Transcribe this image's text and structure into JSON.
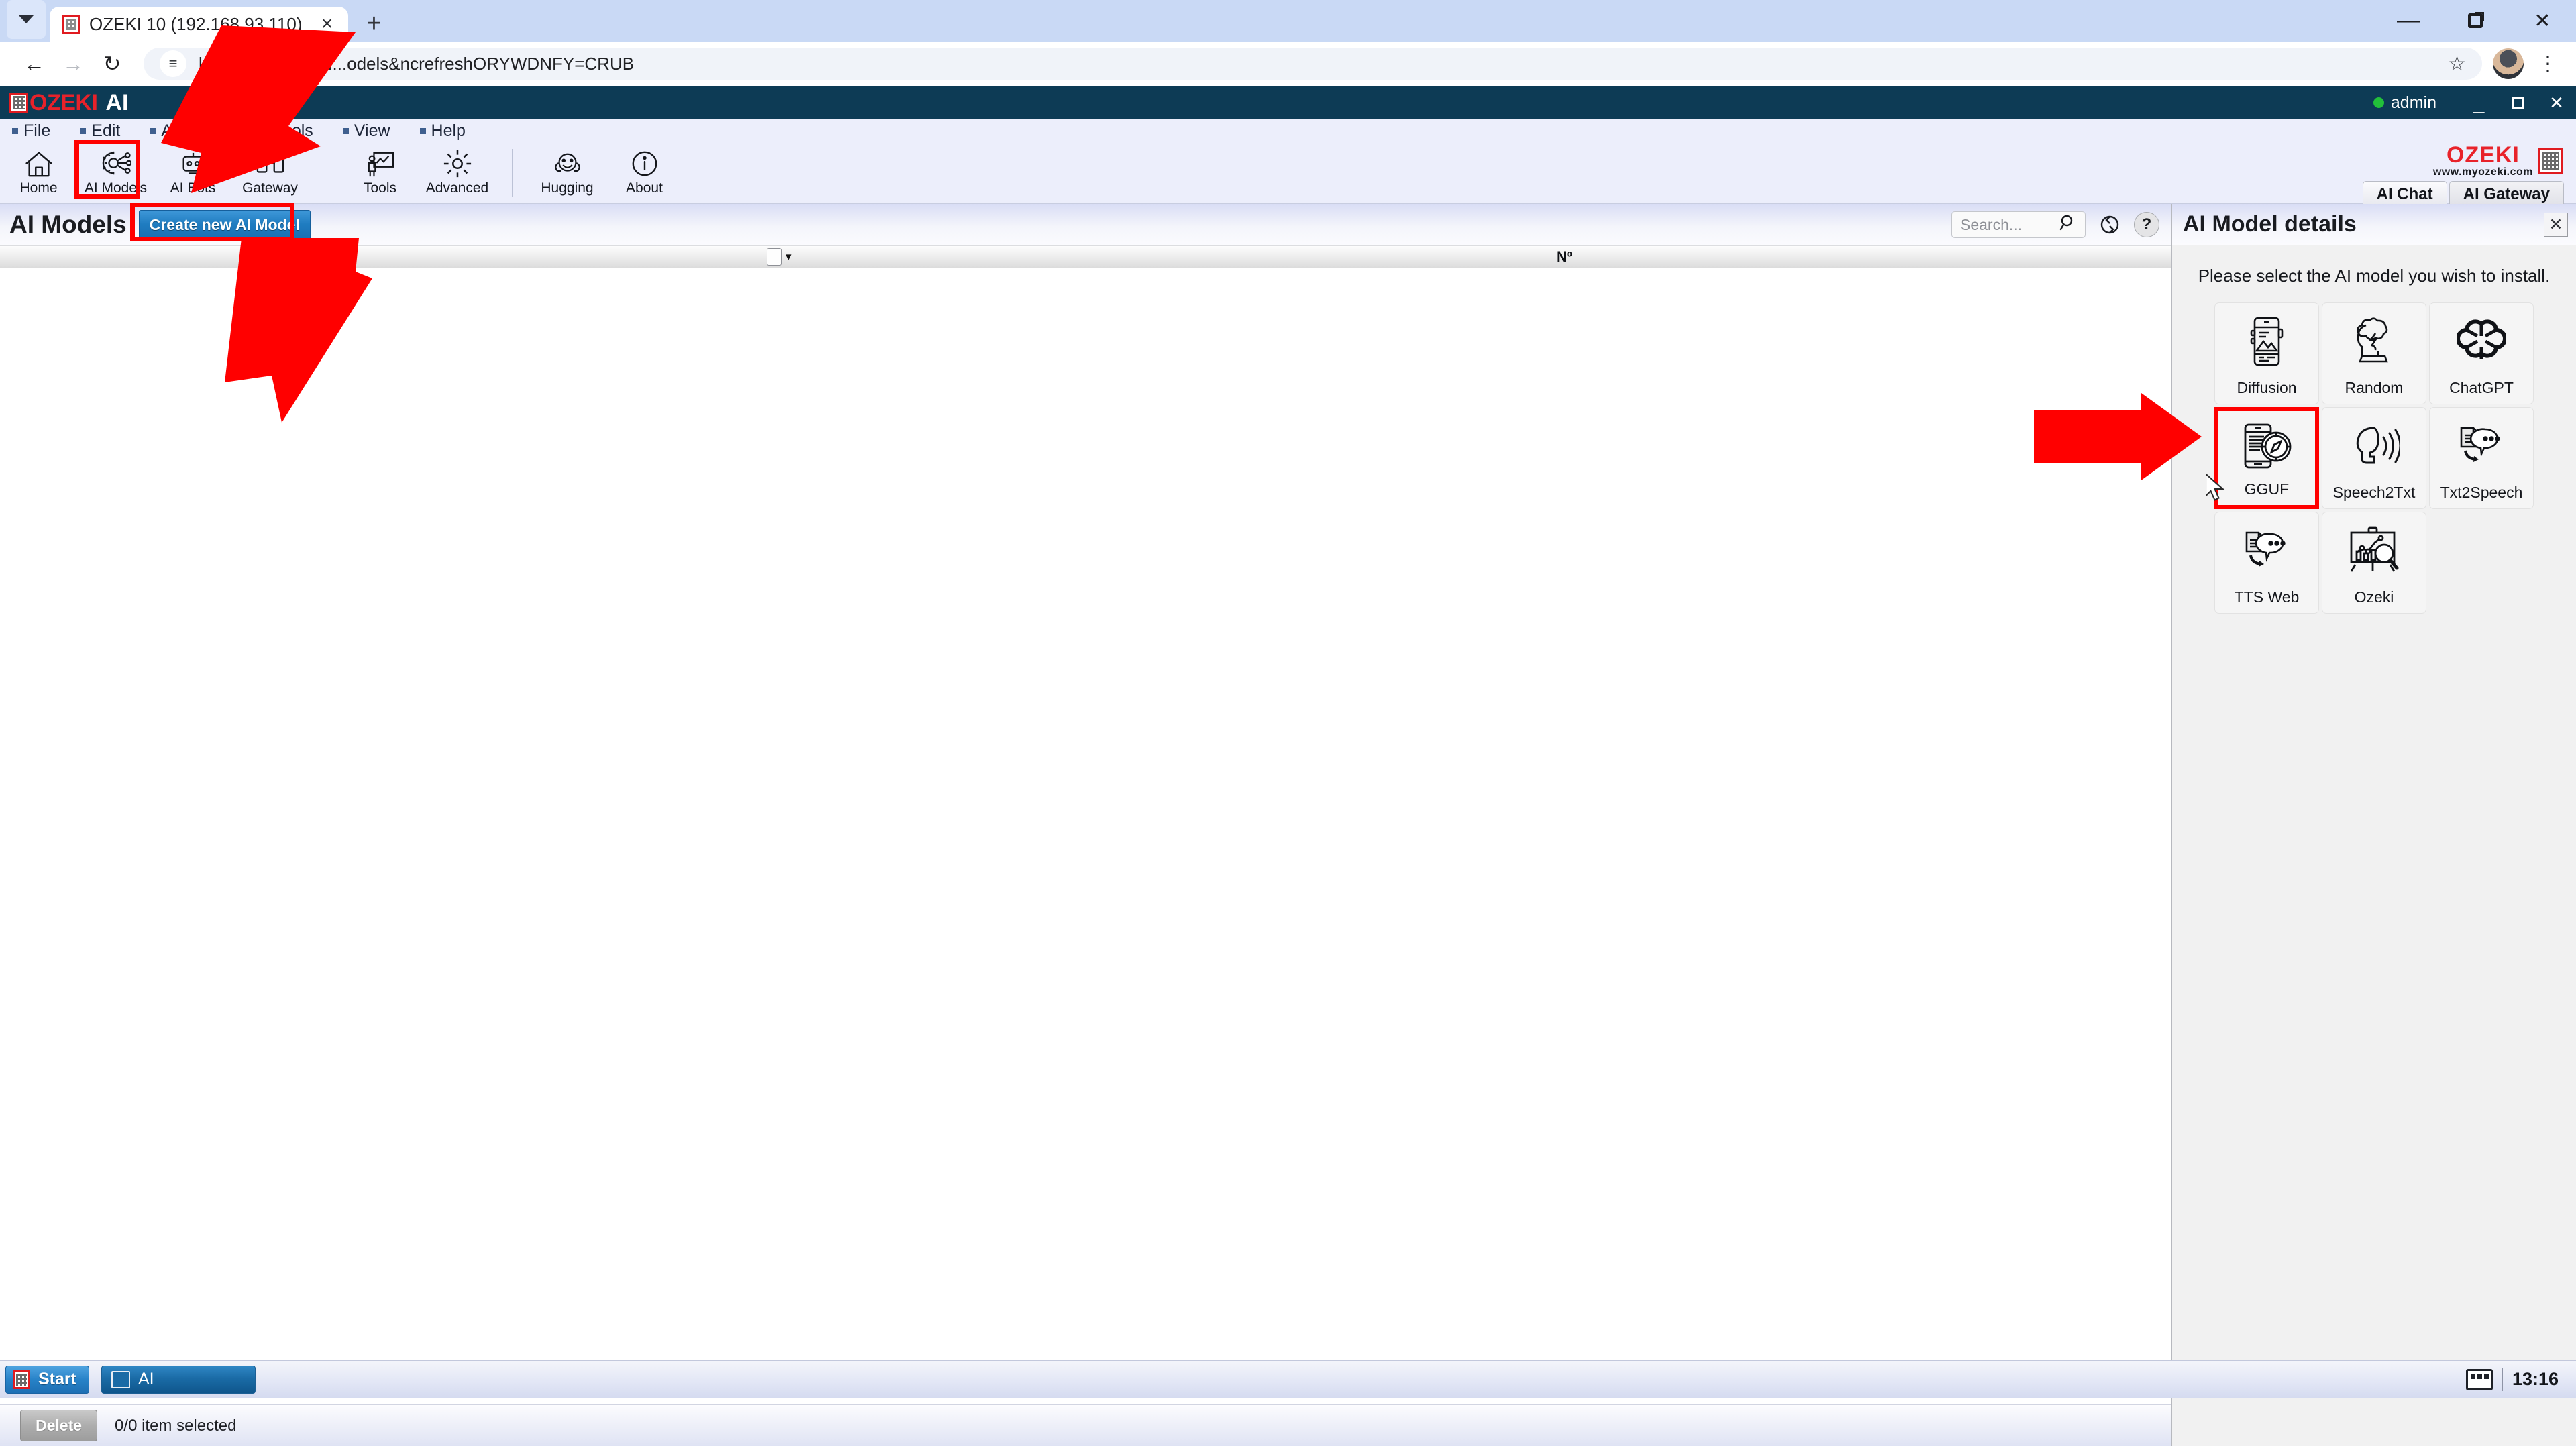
{
  "browser": {
    "tab": {
      "title": "OZEKI 10 (192.168.93.110)",
      "close_label": "×"
    },
    "newtab_label": "+",
    "window": {
      "minimize": "—",
      "maximize": "□",
      "close": "✕"
    },
    "nav": {
      "back": "←",
      "forward": "→",
      "reload": "↻"
    },
    "omnibox": {
      "url": "localhost:9515/AI...odels&ncrefreshORYWDNFY=CRUB",
      "site_icon": "tune-icon"
    },
    "bookmark_label": "☆",
    "menu_label": "⋮"
  },
  "app": {
    "brand": {
      "ozeki": "OZEKI",
      "ai": "AI"
    },
    "header": {
      "user": "admin",
      "minimize": "_",
      "maximize": "□",
      "close": "✕"
    },
    "menubar": [
      {
        "label": "File"
      },
      {
        "label": "Edit"
      },
      {
        "label": "AI Agents"
      },
      {
        "label": "Tools"
      },
      {
        "label": "View"
      },
      {
        "label": "Help"
      }
    ],
    "ribbon": [
      {
        "label": "Home",
        "icon": "home-icon"
      },
      {
        "label": "AI Models",
        "icon": "gear-network-icon"
      },
      {
        "label": "AI Bots",
        "icon": "robot-icon"
      },
      {
        "label": "Gateway",
        "icon": "gateway-icon"
      },
      {
        "label": "Tools",
        "icon": "presentation-icon"
      },
      {
        "label": "Advanced",
        "icon": "gear-icon"
      },
      {
        "label": "Hugging",
        "icon": "hugging-face-icon"
      },
      {
        "label": "About",
        "icon": "info-icon"
      }
    ],
    "logo": {
      "name": "OZEKI",
      "site": "www.myozeki.com",
      "site_my": "my"
    },
    "tabs": [
      {
        "label": "AI Chat",
        "active": true
      },
      {
        "label": "AI Gateway",
        "active": false
      }
    ]
  },
  "page": {
    "title": "AI Models",
    "create_button": "Create new AI Model",
    "search": {
      "placeholder": "Search...",
      "value": ""
    },
    "refresh_icon": "refresh-icon",
    "help_icon": "help-icon",
    "table": {
      "columns": [
        "",
        "Nº"
      ],
      "rows": []
    }
  },
  "statusbar": {
    "delete_label": "Delete",
    "selection_text": "0/0 item selected"
  },
  "details_panel": {
    "title": "AI Model details",
    "close_label": "✕",
    "instruction": "Please select the AI model you wish to install.",
    "tiles": [
      {
        "label": "Diffusion",
        "icon": "phone-image-icon",
        "selected": false
      },
      {
        "label": "Random",
        "icon": "brain-storm-icon",
        "selected": false
      },
      {
        "label": "ChatGPT",
        "icon": "openai-icon",
        "selected": false
      },
      {
        "label": "GGUF",
        "icon": "phone-compass-icon",
        "selected": true
      },
      {
        "label": "Speech2Txt",
        "icon": "speaking-head-icon",
        "selected": false
      },
      {
        "label": "Txt2Speech",
        "icon": "doc-to-bubble-icon",
        "selected": false
      },
      {
        "label": "TTS Web",
        "icon": "doc-to-bubble-icon",
        "selected": false
      },
      {
        "label": "Ozeki",
        "icon": "chart-search-icon",
        "selected": false
      }
    ]
  },
  "taskbar": {
    "start_label": "Start",
    "items": [
      {
        "label": "AI"
      }
    ],
    "tray": {
      "show_desktop_icon": "monitor-icon",
      "clock": "13:16"
    }
  },
  "colors": {
    "brand_red": "#e8222a",
    "header_navy": "#0d3b55",
    "accent_blue": "#1f7cc0",
    "marker_red": "#ff0000",
    "status_green": "#22c03a"
  }
}
